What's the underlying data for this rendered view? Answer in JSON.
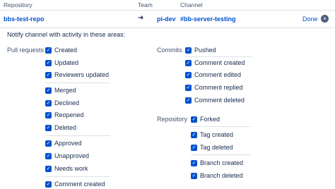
{
  "header": {
    "repository": "Repository",
    "team": "Team",
    "channel": "Channel"
  },
  "row": {
    "repository": "bbs-test-repo",
    "arrow": "➜",
    "team": "pi-dev",
    "channel": "#bb-server-testing",
    "done": "Done",
    "close": "×"
  },
  "intro": "Notify channel with activity in these areas:",
  "pull_requests": {
    "label": "Pull requests",
    "items": [
      "Created",
      "Updated",
      "Reviewers updated",
      "Merged",
      "Declined",
      "Reopened",
      "Deleted",
      "Approved",
      "Unapproved",
      "Needs work",
      "Comment created"
    ]
  },
  "commits": {
    "label": "Commits",
    "items": [
      "Pushed",
      "Comment created",
      "Comment edited",
      "Comment replied",
      "Comment deleted"
    ]
  },
  "repository": {
    "label": "Repository",
    "items": [
      "Forked",
      "Tag created",
      "Tag deleted",
      "Branch created",
      "Branch deleted"
    ]
  },
  "check_glyph": "✓",
  "colors": {
    "accent": "#0052cc",
    "text": "#172b4d",
    "muted": "#42526e",
    "divider": "#dfe1e6"
  }
}
